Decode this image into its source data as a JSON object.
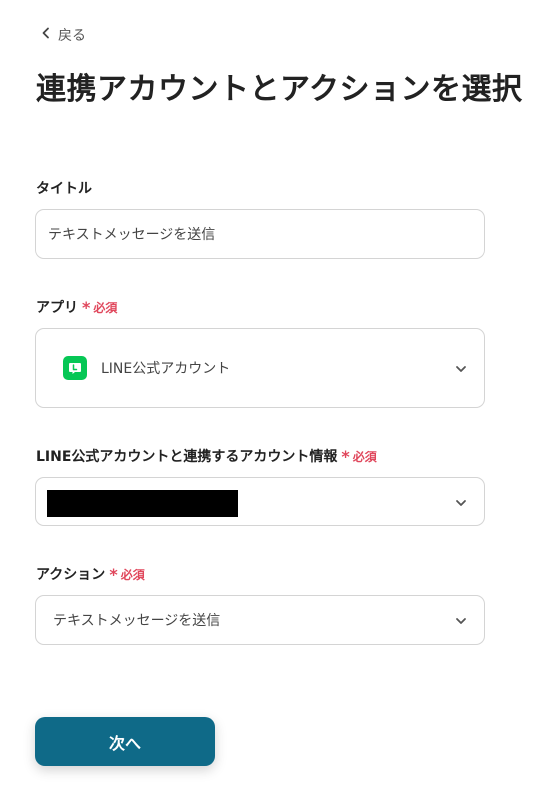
{
  "nav": {
    "back_label": "戻る"
  },
  "page": {
    "title": "連携アカウントとアクションを選択"
  },
  "fields": {
    "title": {
      "label": "タイトル",
      "value": "テキストメッセージを送信"
    },
    "app": {
      "label": "アプリ",
      "required_mark": "*",
      "required_text": "必須",
      "value": "LINE公式アカウント",
      "icon": "line-logo-icon",
      "icon_color": "#06c755"
    },
    "account": {
      "label": "LINE公式アカウントと連携するアカウント情報",
      "required_mark": "*",
      "required_text": "必須",
      "value_redacted": true
    },
    "action": {
      "label": "アクション",
      "required_mark": "*",
      "required_text": "必須",
      "value": "テキストメッセージを送信"
    }
  },
  "buttons": {
    "next_label": "次へ"
  },
  "colors": {
    "primary": "#0f6a88",
    "required": "#e0475c",
    "border": "#d4d4d4"
  }
}
